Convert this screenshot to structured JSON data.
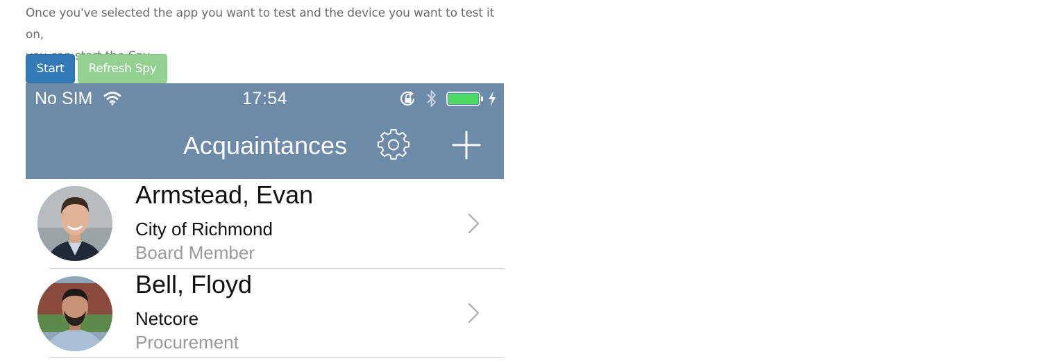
{
  "intro": {
    "line1": "Once you've selected the app you want to test and the device you want to test it on,",
    "line2_prefix": "you can start the ",
    "line2_em": "Spy",
    "line2_suffix": "."
  },
  "buttons": {
    "start_label": "Start",
    "refresh_label": "Refresh Spy"
  },
  "phone": {
    "status_bar": {
      "carrier": "No SIM",
      "time": "17:54",
      "battery_level": 1.0,
      "icons": [
        "wifi-icon",
        "lock-rotation-icon",
        "bluetooth-icon",
        "battery-icon",
        "charging-icon"
      ]
    },
    "navbar": {
      "title": "Acquaintances",
      "icons": [
        "gear-icon",
        "plus-icon"
      ],
      "background": "#6d8aa8"
    },
    "contacts": [
      {
        "name": "Armstead, Evan",
        "company": "City of Richmond",
        "job_title": "Board Member"
      },
      {
        "name": "Bell, Floyd",
        "company": "Netcore",
        "job_title": "Procurement"
      }
    ]
  },
  "colors": {
    "start_button": "#337ab7",
    "refresh_button": "#93d190",
    "battery_fill": "#4cd964",
    "secondary_text": "#9a9a9a"
  }
}
